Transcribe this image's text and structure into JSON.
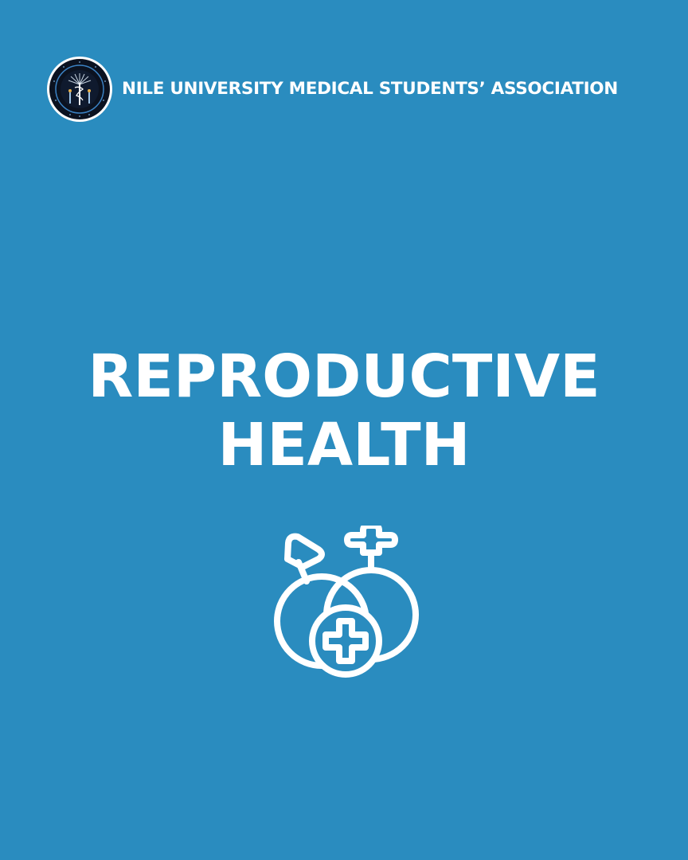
{
  "header": {
    "logo_icon": "nile-university-medical-students-association-seal",
    "logo_text": "NILE UNIVERSITY MEDICAL STUDENTS' ASSOCIATION · N U M S A",
    "org_name": "NILE UNIVERSITY MEDICAL STUDENTS’ ASSOCIATION"
  },
  "main": {
    "title_line1": "REPRODUCTIVE",
    "title_line2": "HEALTH",
    "icon": "reproductive-health-icon"
  },
  "colors": {
    "background": "#2a8cbf",
    "text": "#ffffff",
    "logo_ring": "#0b1220"
  }
}
